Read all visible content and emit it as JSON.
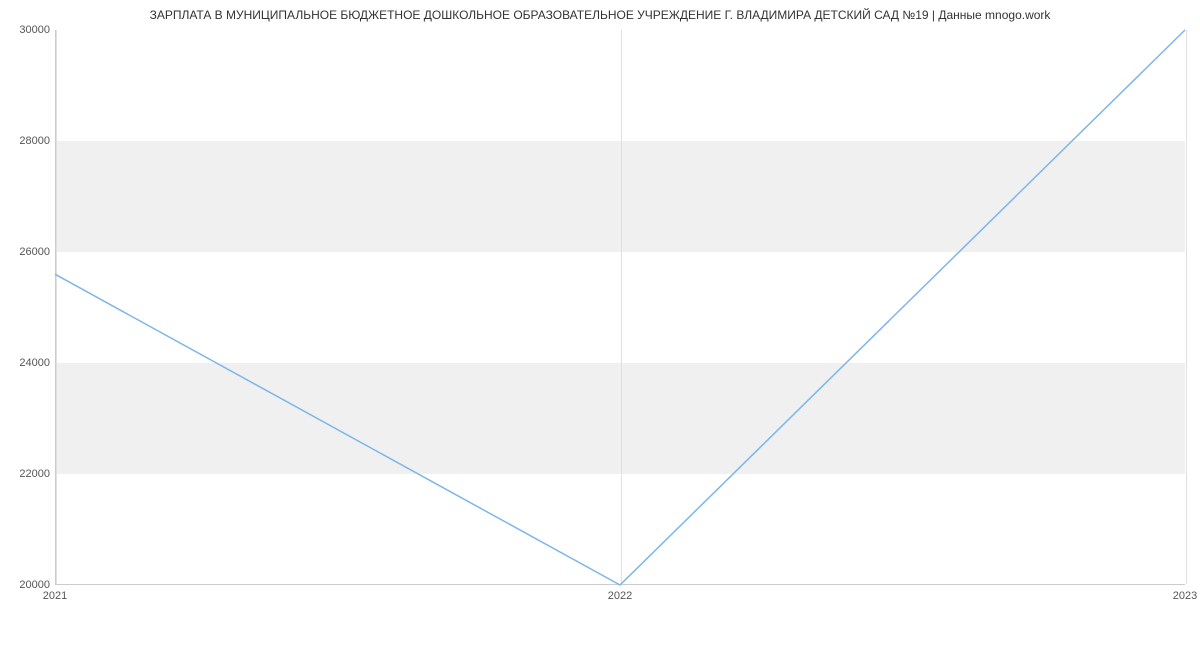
{
  "chart_data": {
    "type": "line",
    "title": "ЗАРПЛАТА В МУНИЦИПАЛЬНОЕ БЮДЖЕТНОЕ ДОШКОЛЬНОЕ ОБРАЗОВАТЕЛЬНОЕ УЧРЕЖДЕНИЕ Г. ВЛАДИМИРА ДЕТСКИЙ САД №19 | Данные mnogo.work",
    "categories": [
      "2021",
      "2022",
      "2023"
    ],
    "values": [
      25600,
      20000,
      30000
    ],
    "xlabel": "",
    "ylabel": "",
    "ylim": [
      20000,
      30000
    ],
    "y_ticks": [
      20000,
      22000,
      24000,
      26000,
      28000,
      30000
    ],
    "line_color": "#7cb5ec",
    "band_color": "#f0f0f0"
  }
}
